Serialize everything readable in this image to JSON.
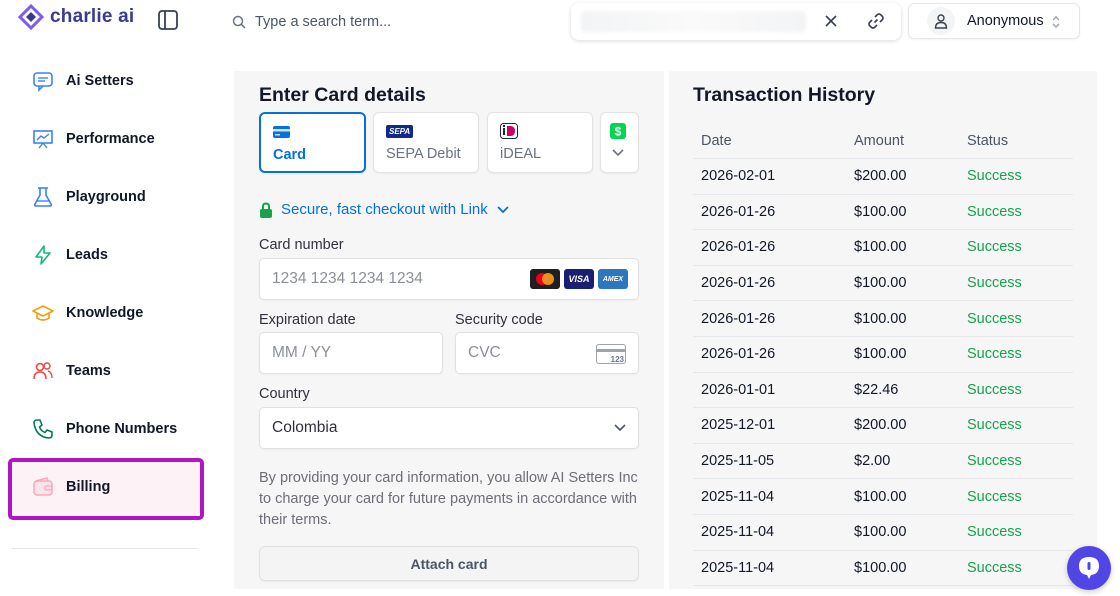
{
  "app": {
    "name": "charlie ai",
    "brand_color": "#6d4bd8"
  },
  "sidebar": {
    "items": [
      {
        "label": "Ai Setters",
        "icon": "chat-icon",
        "color": "#3b82f6"
      },
      {
        "label": "Performance",
        "icon": "presentation-chart-icon",
        "color": "#3b82f6"
      },
      {
        "label": "Playground",
        "icon": "flask-icon",
        "color": "#3b82f6"
      },
      {
        "label": "Leads",
        "icon": "lightning-icon",
        "color": "#10b981"
      },
      {
        "label": "Knowledge",
        "icon": "graduation-cap-icon",
        "color": "#f59e0b"
      },
      {
        "label": "Teams",
        "icon": "users-icon",
        "color": "#ef4444"
      },
      {
        "label": "Phone Numbers",
        "icon": "phone-icon",
        "color": "#047857"
      },
      {
        "label": "Billing",
        "icon": "wallet-icon",
        "color": "#f43f5e",
        "active": true
      }
    ]
  },
  "topbar": {
    "search_placeholder": "Type a search term...",
    "user_name": "Anonymous"
  },
  "card_form": {
    "title": "Enter Card details",
    "payment_methods": [
      {
        "label": "Card",
        "icon": "credit-card-icon",
        "selected": true
      },
      {
        "label": "SEPA Debit",
        "icon": "sepa-icon",
        "badge": "SEPA"
      },
      {
        "label": "iDEAL",
        "icon": "ideal-icon"
      }
    ],
    "link_text": "Secure, fast checkout with Link",
    "card_number_label": "Card number",
    "card_number_placeholder": "1234 1234 1234 1234",
    "card_brands": [
      "mastercard-icon",
      "VISA",
      "AMEX"
    ],
    "expiration_label": "Expiration date",
    "expiration_placeholder": "MM / YY",
    "security_label": "Security code",
    "security_placeholder": "CVC",
    "cvc_hint": "123",
    "country_label": "Country",
    "country_value": "Colombia",
    "disclaimer": "By providing your card information, you allow AI Setters Inc to charge your card for future payments in accordance with their terms.",
    "attach_label": "Attach card"
  },
  "transactions": {
    "title": "Transaction History",
    "headers": {
      "date": "Date",
      "amount": "Amount",
      "status": "Status"
    },
    "rows": [
      {
        "date": "2026-02-01",
        "amount": "$200.00",
        "status": "Success"
      },
      {
        "date": "2026-01-26",
        "amount": "$100.00",
        "status": "Success"
      },
      {
        "date": "2026-01-26",
        "amount": "$100.00",
        "status": "Success"
      },
      {
        "date": "2026-01-26",
        "amount": "$100.00",
        "status": "Success"
      },
      {
        "date": "2026-01-26",
        "amount": "$100.00",
        "status": "Success"
      },
      {
        "date": "2026-01-26",
        "amount": "$100.00",
        "status": "Success"
      },
      {
        "date": "2026-01-01",
        "amount": "$22.46",
        "status": "Success"
      },
      {
        "date": "2025-12-01",
        "amount": "$200.00",
        "status": "Success"
      },
      {
        "date": "2025-11-05",
        "amount": "$2.00",
        "status": "Success"
      },
      {
        "date": "2025-11-04",
        "amount": "$100.00",
        "status": "Success"
      },
      {
        "date": "2025-11-04",
        "amount": "$100.00",
        "status": "Success"
      },
      {
        "date": "2025-11-04",
        "amount": "$100.00",
        "status": "Success"
      }
    ],
    "status_color": "#16a34a"
  }
}
